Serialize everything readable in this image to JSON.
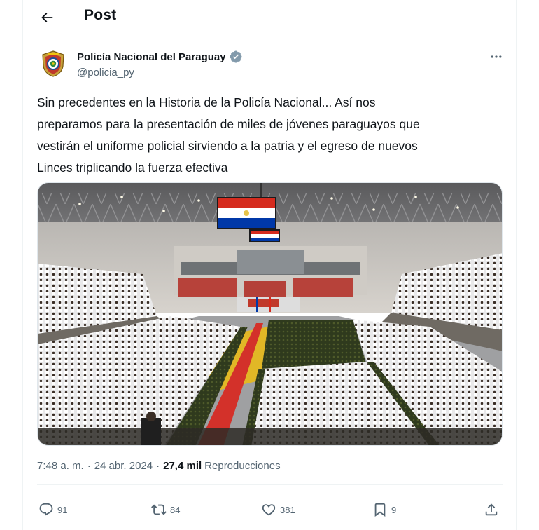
{
  "header": {
    "title": "Post"
  },
  "author": {
    "display_name": "Policía Nacional del Paraguay",
    "handle": "@policia_py",
    "verified": true
  },
  "tweet": {
    "text": "Sin precedentes en la Historia de la Policía Nacional... Así nos\npreparamos para la presentación de miles de jóvenes paraguayos que\nvestirán el uniforme policial sirviendo a la patria y el egreso de nuevos\nLinces triplicando la fuerza efectiva"
  },
  "meta": {
    "time": "7:48 a. m.",
    "separator": "·",
    "date": "24 abr. 2024",
    "views_count": "27,4 mil",
    "views_label": "Reproducciones"
  },
  "actions": {
    "replies": "91",
    "reposts": "84",
    "likes": "381",
    "bookmarks": "9"
  },
  "colors": {
    "text_primary": "#0f1419",
    "text_secondary": "#536471",
    "divider": "#eff3f4",
    "verified_badge": "#829aab"
  },
  "icons": {
    "back": "arrow-left-icon",
    "verified": "verified-badge-icon",
    "more": "more-horizontal-icon",
    "reply": "reply-icon",
    "retweet": "retweet-icon",
    "like": "heart-icon",
    "bookmark": "bookmark-icon",
    "share": "share-icon"
  }
}
